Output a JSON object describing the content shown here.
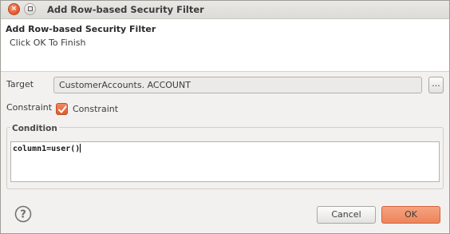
{
  "window": {
    "title": "Add Row-based Security Filter",
    "close_glyph": "×"
  },
  "header": {
    "title": "Add Row-based Security Filter",
    "subtitle": "Click OK To Finish"
  },
  "form": {
    "target_label": "Target",
    "target_value": "CustomerAccounts. ACCOUNT",
    "browse_label": "...",
    "constraint_label": "Constraint",
    "constraint_checkbox_label": "Constraint",
    "constraint_checked": true,
    "condition_group_title": "Condition",
    "condition_value": "column1=user()"
  },
  "footer": {
    "help_icon": "help-icon",
    "cancel_label": "Cancel",
    "ok_label": "OK"
  },
  "colors": {
    "accent": "#e8693f",
    "ok_button": "#f39a74",
    "dialog_bg": "#f2f1f0"
  }
}
